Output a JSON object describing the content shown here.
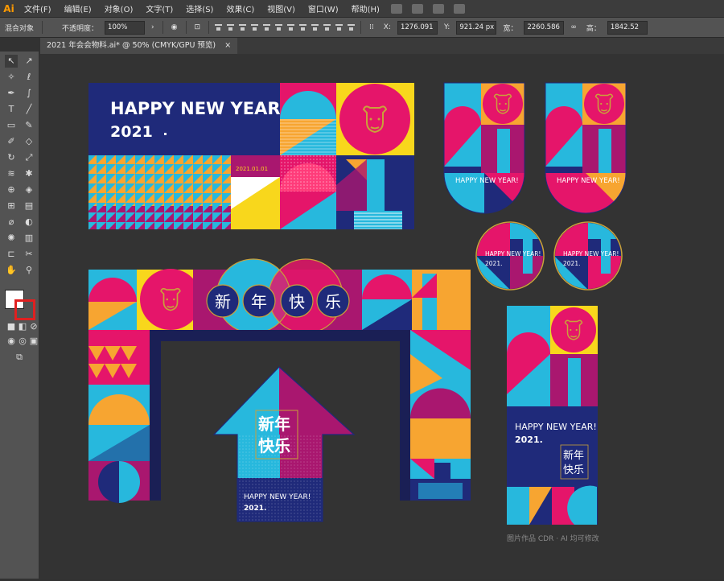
{
  "app": {
    "logo": "Ai"
  },
  "menu": [
    "文件(F)",
    "编辑(E)",
    "对象(O)",
    "文字(T)",
    "选择(S)",
    "效果(C)",
    "视图(V)",
    "窗口(W)",
    "帮助(H)"
  ],
  "control": {
    "object_type": "混合对象",
    "opacity_label": "不透明度：",
    "opacity_value": "100%",
    "x_label": "X:",
    "x_value": "1276.091",
    "y_label": "Y:",
    "y_value": "921.24 px",
    "w_label": "宽：",
    "w_value": "2260.586",
    "h_label": "高：",
    "h_value": "1842.52"
  },
  "document_tab": {
    "title": "2021 年会会物料.ai* @ 50% (CMYK/GPU 预览)",
    "close": "×"
  },
  "artwork": {
    "banner_heading": "HAPPY NEW YEAR!",
    "banner_year": "2021",
    "banner_date": "2021.01.01",
    "card_text": "HAPPY NEW YEAR!",
    "badge_line1": "HAPPY NEW YEAR!",
    "badge_line2": "2021.",
    "arch_chars": [
      "新",
      "年",
      "快",
      "乐"
    ],
    "arrow_title_line1": "新年",
    "arrow_title_line2": "快乐",
    "arrow_heading": "HAPPY NEW YEAR!",
    "arrow_year": "2021.",
    "poster_heading": "HAPPY NEW YEAR!",
    "poster_year": "2021.",
    "poster_cn_1": "新年",
    "poster_cn_2": "快乐",
    "watermark": "图片作品 CDR · AI 均可修改"
  },
  "colors": {
    "navy": "#1f2a7a",
    "pink": "#e5156a",
    "cyan": "#27b8dd",
    "orange": "#f7a531",
    "yellow": "#f8d71c",
    "magenta": "#a9176f",
    "gold": "#c9a13a"
  }
}
